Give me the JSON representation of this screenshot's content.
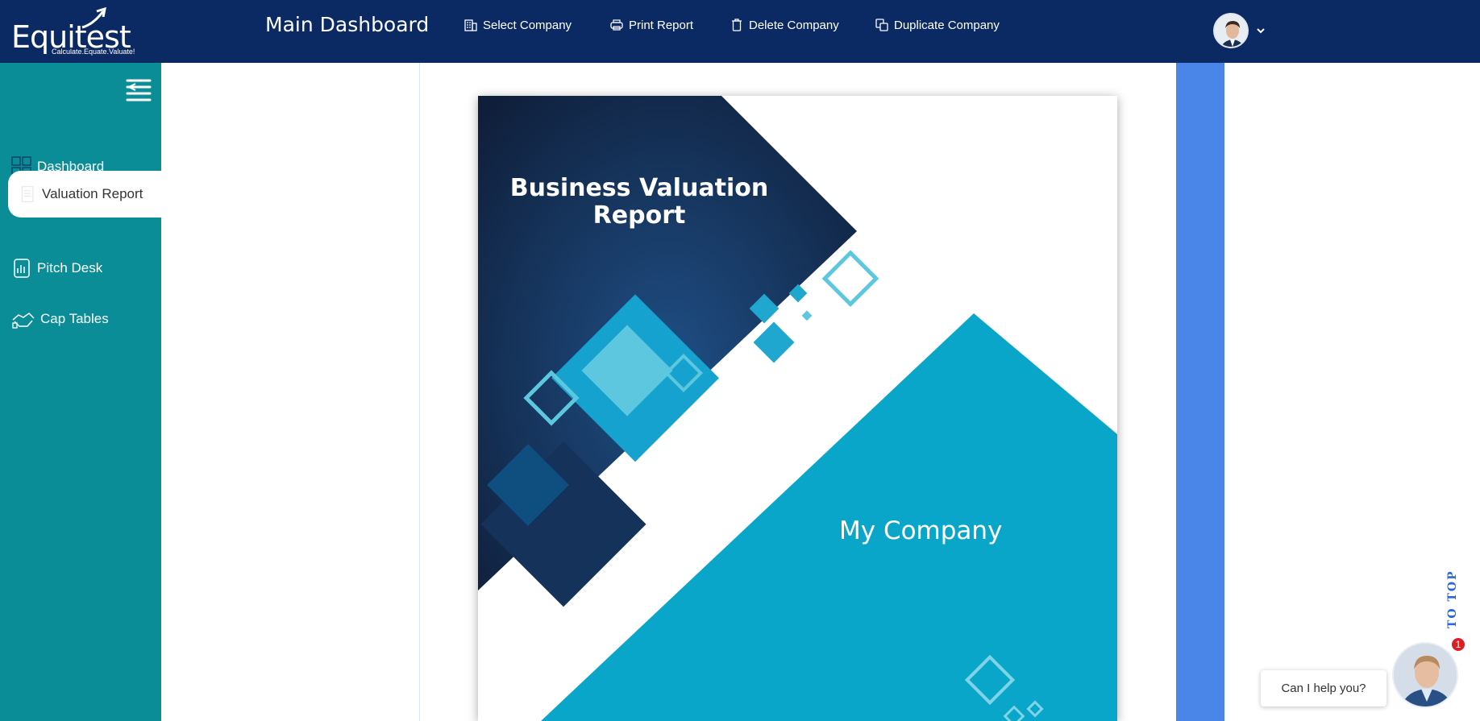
{
  "brand": {
    "name": "Equitest",
    "tagline": "Calculate.Equate.Valuate!"
  },
  "header": {
    "title": "Main Dashboard",
    "actions": [
      {
        "label": "Select Company",
        "icon": "building-icon"
      },
      {
        "label": "Print Report",
        "icon": "printer-icon"
      },
      {
        "label": "Delete Company",
        "icon": "trash-icon"
      },
      {
        "label": "Duplicate Company",
        "icon": "duplicate-icon"
      }
    ]
  },
  "sidebar": {
    "items": [
      {
        "label": "Dashboard",
        "icon": "grid-icon"
      },
      {
        "label": "Valuation Report",
        "icon": "document-icon",
        "active": true
      },
      {
        "label": "Pitch Desk",
        "icon": "report-icon"
      },
      {
        "label": "Cap Tables",
        "icon": "handshake-icon"
      }
    ]
  },
  "report": {
    "title": "Business Valuation Report",
    "company": "My Company"
  },
  "widgets": {
    "to_top": "TO TOP",
    "help": "Can I help you?",
    "badge": "1"
  },
  "colors": {
    "header": "#0b2a63",
    "sidebar": "#0a8d96",
    "accent_bar": "#4a86e8",
    "report_cyan": "#0aa6c9",
    "report_navy": "#13294f"
  }
}
